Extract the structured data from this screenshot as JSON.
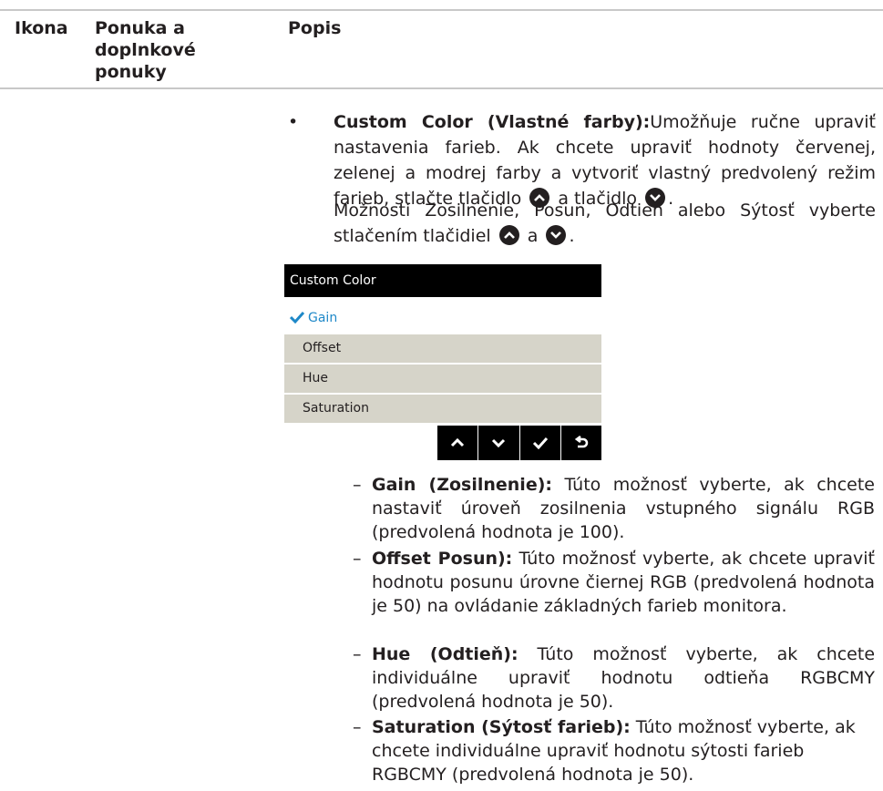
{
  "header": {
    "col_icon": "Ikona",
    "col_menu": "Ponuka a doplnkové ponuky",
    "col_desc": "Popis"
  },
  "custom_color": {
    "term": "Custom Color (Vlastné farby):",
    "text1": "Umožňuje ručne upraviť nastavenia farieb. Ak chcete upraviť hodnoty červenej, zelenej a modrej farby a vytvoriť vlastný predvolený režim farieb, stlačte tlačidlo",
    "text1_mid": "a tlačidlo",
    "text1_end": ".",
    "text2": "Možnosti Zosilnenie, Posun, Odtieň alebo Sýtosť vyberte stlačením tlačidiel",
    "text2_mid": "a",
    "text2_end": "."
  },
  "osd_menu": {
    "title": "Custom Color",
    "items": [
      "Gain",
      "Offset",
      "Hue",
      "Saturation"
    ],
    "selected": "Gain",
    "accent_color": "#1e88c8",
    "nav_buttons": [
      "chevron-up-icon",
      "chevron-down-icon",
      "checkmark-icon",
      "back-icon"
    ]
  },
  "options": [
    {
      "term": "Gain (Zosilnenie):",
      "text": " Túto možnosť vyberte, ak chcete nastaviť úroveň zosilnenia vstupného signálu RGB (predvolená hodnota je 100)."
    },
    {
      "term": "Offset Posun):",
      "text": " Túto možnosť vyberte, ak chcete upraviť hodnotu posunu úrovne čiernej RGB (predvolená hodnota je 50) na ovládanie základných farieb monitora."
    },
    {
      "term": "Hue (Odtieň):",
      "text": " Túto možnosť vyberte, ak chcete individuálne upraviť hodnotu odtieňa RGBCMY (predvolená hodnota je 50)."
    },
    {
      "term": "Saturation (Sýtosť farieb):",
      "text": " Túto možnosť vyberte, ak chcete individuálne upraviť hodnotu sýtosti farieb RGBCMY (predvolená hodnota je 50)."
    }
  ]
}
